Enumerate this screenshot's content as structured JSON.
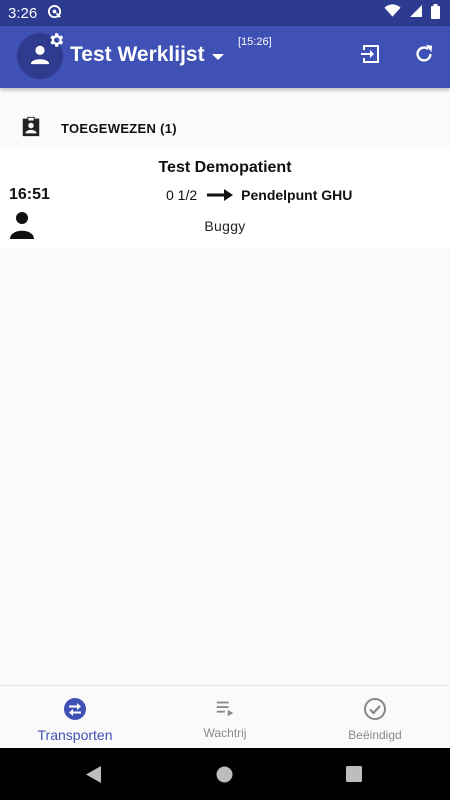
{
  "status_bar": {
    "time": "3:26"
  },
  "app_bar": {
    "title": "Test Werklijst",
    "time": "[15:26]"
  },
  "section": {
    "label": "TOEGEWEZEN (1)"
  },
  "transport": {
    "patient": "Test Demopatient",
    "time": "16:51",
    "origin": "0 1/2",
    "destination": "Pendelpunt GHU",
    "vehicle": "Buggy"
  },
  "bottom_nav": {
    "items": [
      {
        "label": "Transporten"
      },
      {
        "label": "Wachtrij"
      },
      {
        "label": "Beëindigd"
      }
    ]
  },
  "colors": {
    "primary": "#3f51b5",
    "primary_dark": "#2c3a8f"
  }
}
